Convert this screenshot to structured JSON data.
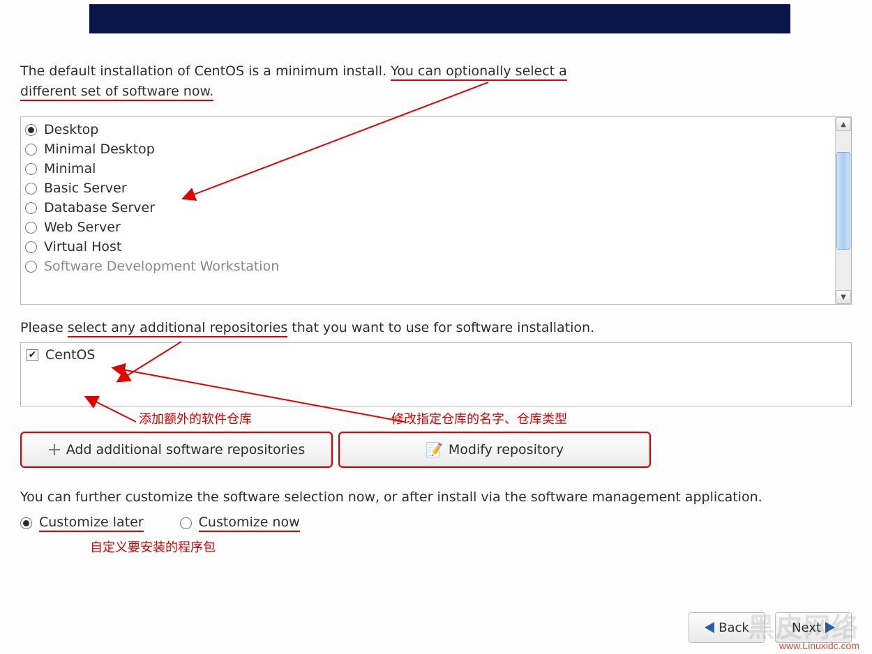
{
  "intro": {
    "pre": "The default installation of CentOS is a minimum install. ",
    "underlined1": "You can optionally select a",
    "underlined2": "different set of software now."
  },
  "software_options": [
    {
      "label": "Desktop",
      "selected": true
    },
    {
      "label": "Minimal Desktop",
      "selected": false
    },
    {
      "label": "Minimal",
      "selected": false
    },
    {
      "label": "Basic Server",
      "selected": false
    },
    {
      "label": "Database Server",
      "selected": false
    },
    {
      "label": "Web Server",
      "selected": false
    },
    {
      "label": "Virtual Host",
      "selected": false
    },
    {
      "label": "Software Development Workstation",
      "selected": false,
      "truncated": true
    }
  ],
  "repo_label": {
    "pre": "Please ",
    "underlined": "select any additional repositories",
    "post": " that you want to use for software installation."
  },
  "repositories": [
    {
      "label": "CentOS",
      "checked": true
    }
  ],
  "annotations": {
    "add_repo": "添加额外的软件仓库",
    "modify_repo": "修改指定仓库的名字、仓库类型",
    "customize": "自定义要安装的程序包"
  },
  "buttons": {
    "add_repo": "Add additional software repositories",
    "modify_repo": "Modify repository"
  },
  "customize_text": "You can further customize the software selection now, or after install via the software management application.",
  "customize_options": [
    {
      "label": "Customize later",
      "selected": true
    },
    {
      "label": "Customize now",
      "selected": false
    }
  ],
  "nav": {
    "back": "Back",
    "next": "Next"
  },
  "watermark": {
    "brand": "黑皮网络",
    "url": "www.Linuxidc.com"
  }
}
